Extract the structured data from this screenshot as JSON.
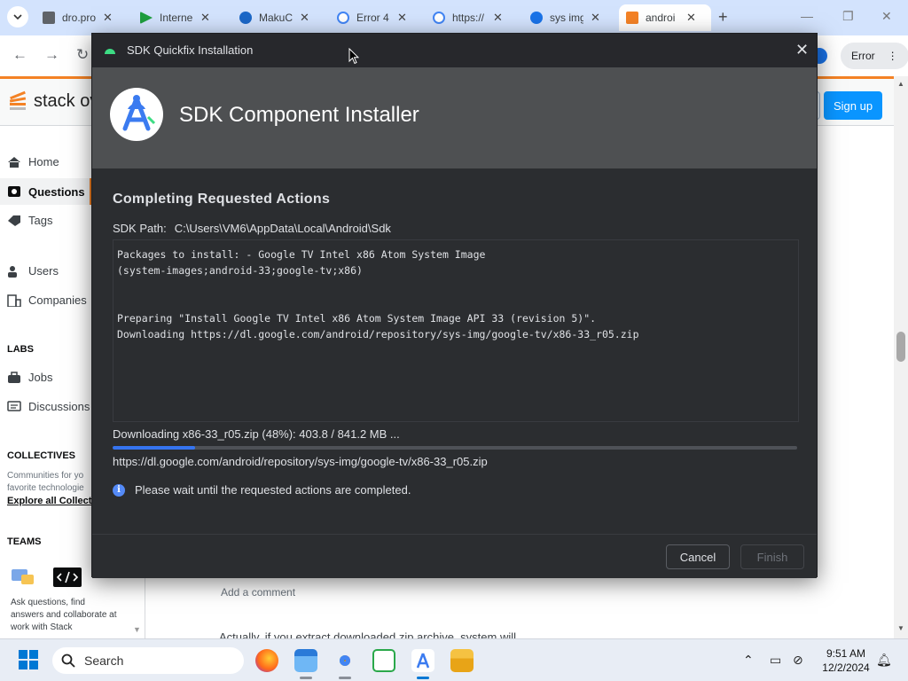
{
  "browser": {
    "tabs": [
      {
        "label": "dro.pro",
        "color": "#5f6368"
      },
      {
        "label": "Interne",
        "color": "#1e9e3e"
      },
      {
        "label": "MakuC",
        "color": "#1c68c8"
      },
      {
        "label": "Error 4",
        "color": "#4285f4"
      },
      {
        "label": "https://",
        "color": "#4285f4"
      },
      {
        "label": "sys img",
        "color": "#1a73e8"
      },
      {
        "label": "androi",
        "color": "#f48225"
      }
    ],
    "new_tab": "+",
    "error_chip": "Error",
    "menu_dots": "⋮"
  },
  "so": {
    "logo_text": "stack ove",
    "signup": "Sign up",
    "nav": {
      "home": "Home",
      "questions": "Questions",
      "tags": "Tags",
      "users": "Users",
      "companies": "Companies",
      "labs": "LABS",
      "jobs": "Jobs",
      "discussions": "Discussions",
      "collectives": "COLLECTIVES",
      "collectives_text_1": "Communities for yo",
      "collectives_text_2": "favorite technologie",
      "explore": "Explore all Collecti",
      "teams": "TEAMS",
      "teams_text": "Ask questions, find answers and collaborate at work with Stack"
    },
    "add_comment": "Add a comment",
    "peek_text": "Actually, if you extract downloaded zip archive, system will"
  },
  "dialog": {
    "window_title": "SDK Quickfix Installation",
    "banner_title": "SDK Component Installer",
    "section_title": "Completing Requested Actions",
    "sdk_path_label": "SDK Path:",
    "sdk_path_value": "C:\\Users\\VM6\\AppData\\Local\\Android\\Sdk",
    "log_text": "Packages to install: - Google TV Intel x86 Atom System Image\n(system-images;android-33;google-tv;x86)\n\n\nPreparing \"Install Google TV Intel x86 Atom System Image API 33 (revision 5)\".\nDownloading https://dl.google.com/android/repository/sys-img/google-tv/x86-33_r05.zip",
    "progress_label": "Downloading x86-33_r05.zip (48%): 403.8 / 841.2 MB ...",
    "progress_percent": 12,
    "progress_url": "https://dl.google.com/android/repository/sys-img/google-tv/x86-33_r05.zip",
    "wait_message": "Please wait until the requested actions are completed.",
    "cancel": "Cancel",
    "finish": "Finish",
    "accent_color": "#3574f0"
  },
  "taskbar": {
    "search_placeholder": "Search",
    "time": "9:51 AM",
    "date": "12/2/2024"
  }
}
